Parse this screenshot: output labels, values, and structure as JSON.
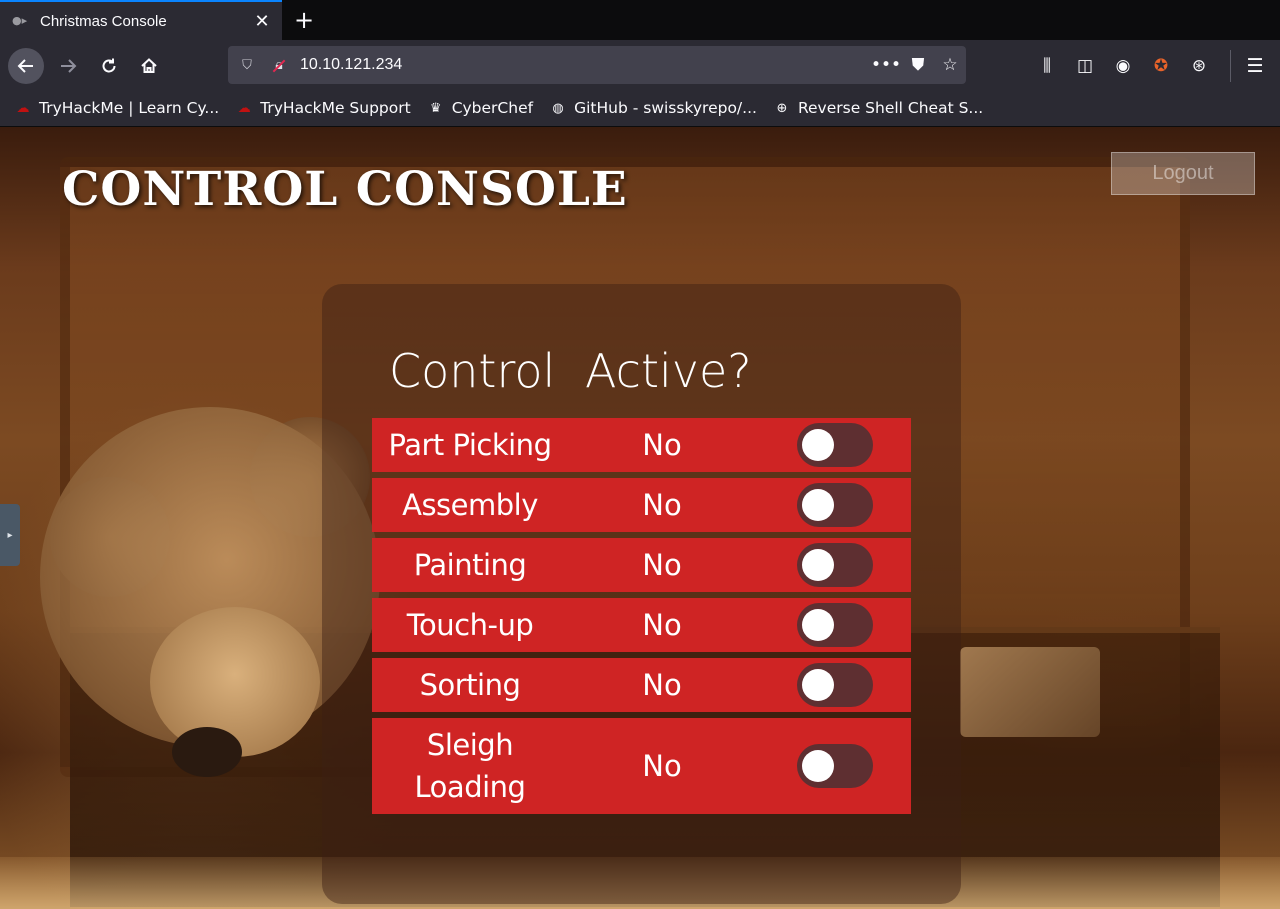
{
  "browser": {
    "tab_title": "Christmas Console",
    "url": "10.10.121.234",
    "bookmarks": [
      {
        "label": "TryHackMe | Learn Cy...",
        "icon": "tryhackme-icon"
      },
      {
        "label": "TryHackMe Support",
        "icon": "tryhackme-icon"
      },
      {
        "label": "CyberChef",
        "icon": "chef-hat-icon"
      },
      {
        "label": "GitHub - swisskyrepo/...",
        "icon": "github-icon"
      },
      {
        "label": "Reverse Shell Cheat S...",
        "icon": "globe-icon"
      }
    ]
  },
  "page": {
    "title": "CONTROL CONSOLE",
    "logout_label": "Logout",
    "table_header": {
      "control": "Control",
      "active": "Active?"
    },
    "controls": [
      {
        "name": "Part Picking",
        "status": "No",
        "active": false
      },
      {
        "name": "Assembly",
        "status": "No",
        "active": false
      },
      {
        "name": "Painting",
        "status": "No",
        "active": false
      },
      {
        "name": "Touch-up",
        "status": "No",
        "active": false
      },
      {
        "name": "Sorting",
        "status": "No",
        "active": false
      },
      {
        "name": "Sleigh Loading",
        "status": "No",
        "active": false
      }
    ]
  },
  "colors": {
    "row_background": "#cf2424",
    "toggle_off": "#5e2f31",
    "accent": "#0a84ff"
  }
}
